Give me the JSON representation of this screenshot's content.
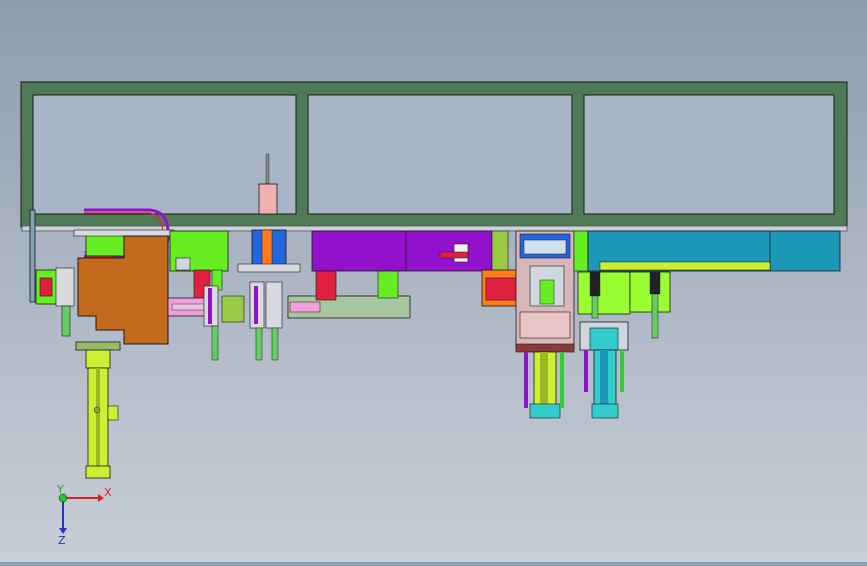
{
  "triad": {
    "x_label": "X",
    "y_label": "Y",
    "z_label": "Z"
  },
  "colors": {
    "background_top": "#8e9cae",
    "background_bottom": "#c8ced6",
    "frame": "#4f7a55",
    "frame_inner": "#a8b6c6",
    "outline": "#1a1a1a",
    "green": "#66ee22",
    "lime": "#99ff33",
    "brown": "#c46a1c",
    "purple": "#9411cc",
    "magenta": "#cc11aa",
    "teal": "#1c99b8",
    "cyan": "#33cccc",
    "yellow": "#ccee33",
    "pink": "#f0a0d8",
    "red": "#e02040",
    "orange": "#ff7a1a",
    "blue": "#2266dd",
    "sage": "#a8c7a0"
  }
}
